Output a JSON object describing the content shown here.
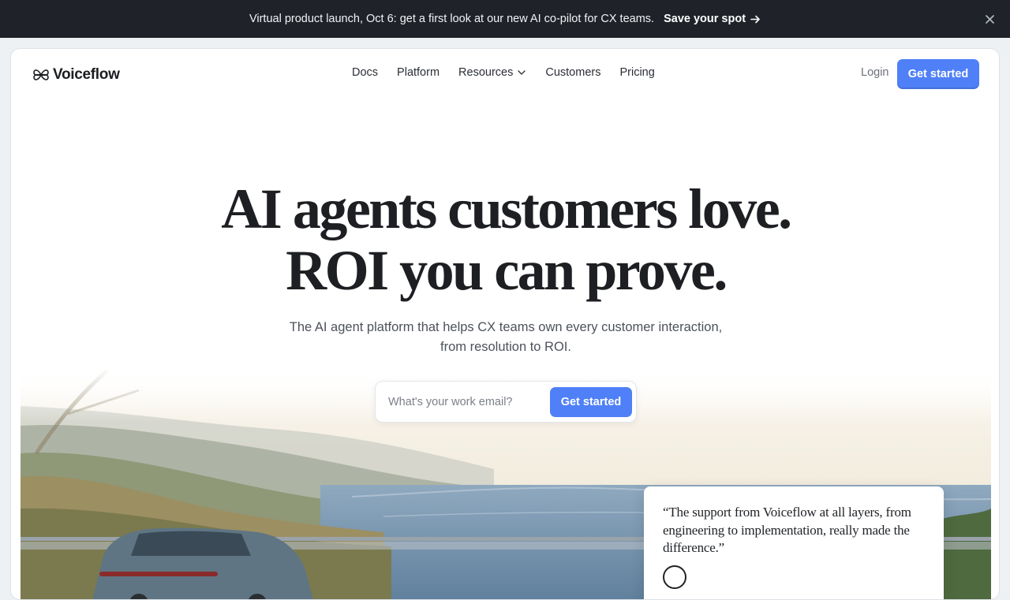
{
  "announcement": {
    "message": "Virtual product launch, Oct 6: get a first look at our new AI co-pilot for CX teams.",
    "cta": "Save your spot",
    "cta_icon": "arrow-right-icon",
    "close_icon": "close-icon"
  },
  "nav": {
    "logo": "Voiceflow",
    "logo_icon": "voiceflow-logo-icon",
    "items": [
      {
        "label": "Docs"
      },
      {
        "label": "Platform"
      },
      {
        "label": "Resources",
        "icon": "chevron-down-icon"
      },
      {
        "label": "Customers"
      },
      {
        "label": "Pricing"
      }
    ],
    "login": "Login",
    "cta": "Get started"
  },
  "hero": {
    "headline_line1": "AI agents customers love.",
    "headline_line2": "ROI you can prove.",
    "subhead_line1": "The AI agent platform that helps CX teams own every customer interaction,",
    "subhead_line2": "from resolution to ROI."
  },
  "email_form": {
    "placeholder": "What's your work email?",
    "value": "",
    "cta": "Get started"
  },
  "testimonial": {
    "quote": "“The support from Voiceflow at all layers, from engineering to implementation, really made the difference.”"
  },
  "colors": {
    "accent": "#4f80f7",
    "announcement_bg": "#1f2329",
    "text": "#1d1f23"
  }
}
